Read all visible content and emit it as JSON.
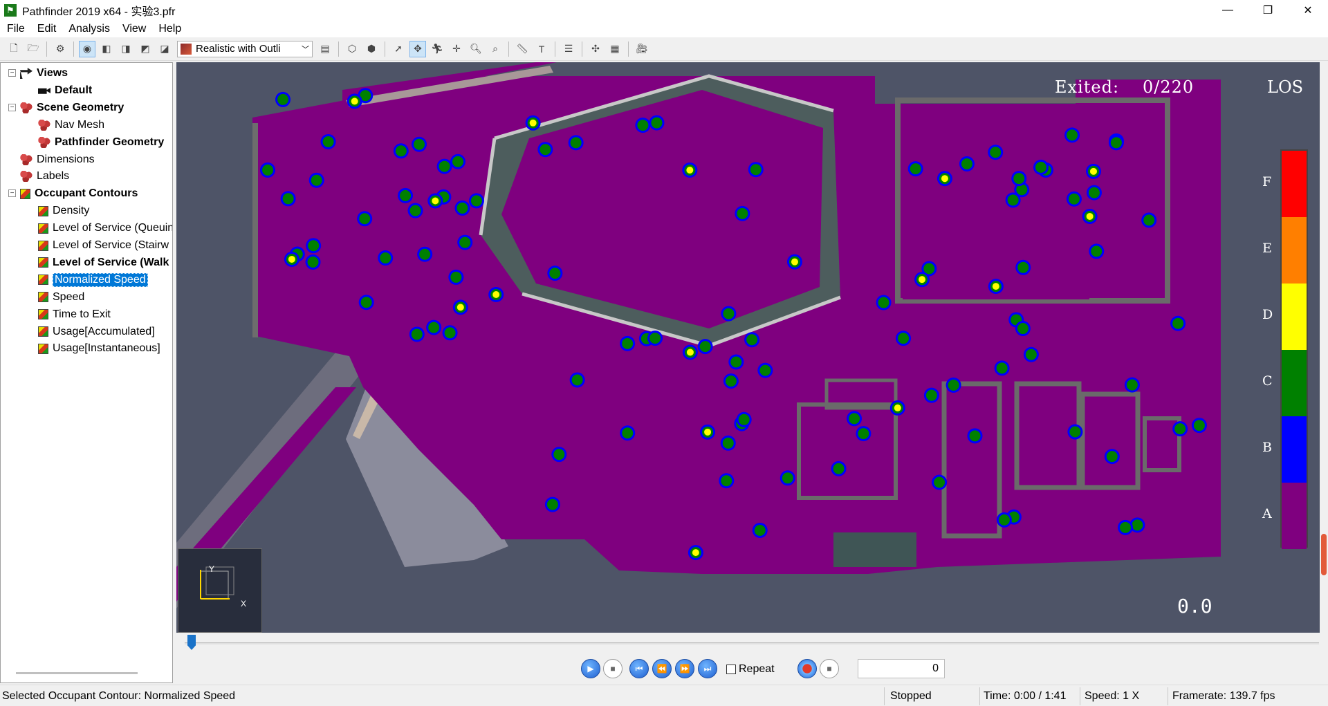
{
  "window": {
    "app_icon": "person-running-icon",
    "title": "Pathfinder 2019 x64 - 实验3.pfr",
    "controls": [
      "minimize",
      "restore",
      "close"
    ]
  },
  "menu": [
    "File",
    "Edit",
    "Analysis",
    "View",
    "Help"
  ],
  "toolbar": {
    "render_mode": "Realistic with Outli",
    "icons": [
      "new-file-icon",
      "open-file-icon",
      "settings-icon",
      "orbit-icon",
      "view-front-icon",
      "view-side-icon",
      "view-top-icon",
      "view-iso-icon",
      "render-mode-icon",
      "color-legend-icon",
      "geometry-icon",
      "geometry-outline-icon",
      "select-icon",
      "pan-icon",
      "walk-icon",
      "move-icon",
      "zoom-icon",
      "zoom-fit-icon",
      "measure-icon",
      "text-icon",
      "align-icon",
      "axis-icon",
      "grid-icon",
      "camera-icon"
    ]
  },
  "tree": {
    "items": [
      {
        "label": "Views",
        "icon": "views-icon",
        "bold": true,
        "level": 0,
        "expanded": true
      },
      {
        "label": "Default",
        "icon": "camera-icon",
        "bold": true,
        "level": 1
      },
      {
        "label": "Scene Geometry",
        "icon": "geometry-icon",
        "bold": true,
        "level": 0,
        "expanded": true
      },
      {
        "label": "Nav Mesh",
        "icon": "geometry-icon",
        "bold": false,
        "level": 1
      },
      {
        "label": "Pathfinder Geometry",
        "icon": "geometry-icon",
        "bold": true,
        "level": 1
      },
      {
        "label": "Dimensions",
        "icon": "geometry-icon",
        "bold": false,
        "level": 0
      },
      {
        "label": "Labels",
        "icon": "geometry-icon",
        "bold": false,
        "level": 0
      },
      {
        "label": "Occupant Contours",
        "icon": "contour-icon",
        "bold": true,
        "level": 0,
        "expanded": true
      },
      {
        "label": "Density",
        "icon": "contour-icon",
        "bold": false,
        "level": 1
      },
      {
        "label": "Level of Service (Queuin",
        "icon": "contour-icon",
        "bold": false,
        "level": 1
      },
      {
        "label": "Level of Service (Stairw",
        "icon": "contour-icon",
        "bold": false,
        "level": 1
      },
      {
        "label": "Level of Service (Walk",
        "icon": "contour-icon",
        "bold": true,
        "level": 1
      },
      {
        "label": "Normalized Speed",
        "icon": "contour-icon",
        "bold": false,
        "level": 1,
        "selected": true
      },
      {
        "label": "Speed",
        "icon": "contour-icon",
        "bold": false,
        "level": 1
      },
      {
        "label": "Time to Exit",
        "icon": "contour-icon",
        "bold": false,
        "level": 1
      },
      {
        "label": "Usage[Accumulated]",
        "icon": "contour-icon",
        "bold": false,
        "level": 1
      },
      {
        "label": "Usage[Instantaneous]",
        "icon": "contour-icon",
        "bold": false,
        "level": 1
      }
    ]
  },
  "viewport": {
    "exited_label": "Exited:",
    "exited_count": "0/220",
    "legend_title": "LOS",
    "legend": [
      {
        "grade": "F",
        "color": "#ff0000"
      },
      {
        "grade": "E",
        "color": "#ff7f00"
      },
      {
        "grade": "D",
        "color": "#ffff00"
      },
      {
        "grade": "C",
        "color": "#008000"
      },
      {
        "grade": "B",
        "color": "#0000ff"
      },
      {
        "grade": "A",
        "color": "#7f007f"
      }
    ],
    "clock": "0.0",
    "axis_y": "Y",
    "axis_x": "X"
  },
  "playback": {
    "progress": 0,
    "repeat_label": "Repeat",
    "repeat_checked": false,
    "frame": "0"
  },
  "status": {
    "message": "Selected Occupant Contour: Normalized Speed",
    "state": "Stopped",
    "time": "Time: 0:00 / 1:41",
    "speed": "Speed: 1 X",
    "framerate": "Framerate: 139.7 fps"
  }
}
